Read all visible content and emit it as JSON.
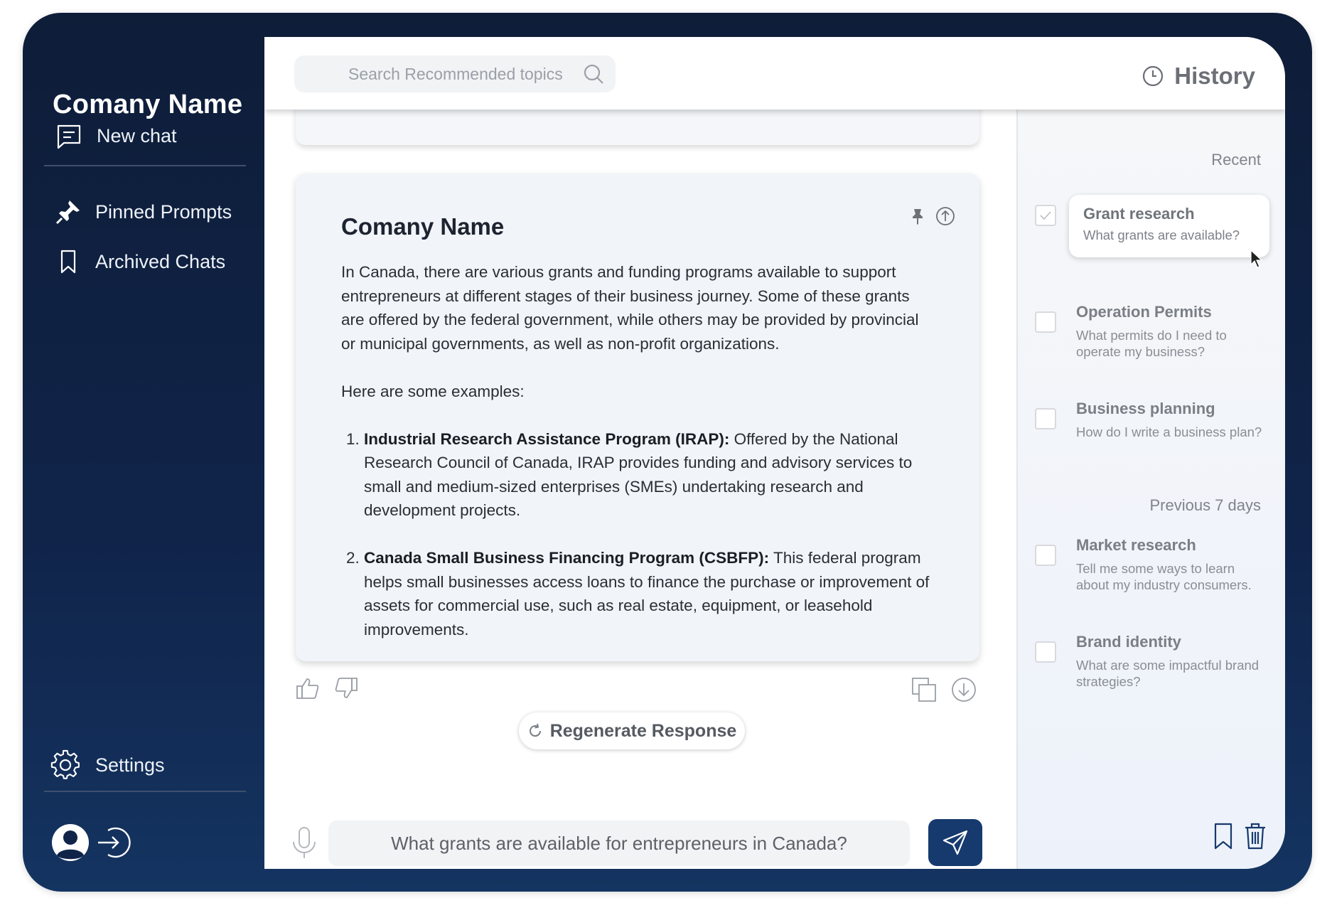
{
  "sidebar": {
    "brand": "Comany Name",
    "new_chat": "New chat",
    "pinned": "Pinned Prompts",
    "archived": "Archived Chats",
    "settings": "Settings"
  },
  "topbar": {
    "search_placeholder": "Search Recommended topics",
    "history_label": "History"
  },
  "message": {
    "title": "Comany Name",
    "intro": "In Canada, there are various grants and funding programs available to support entrepreneurs at different stages of their business journey. Some of these grants are offered by the federal government, while others may be provided by provincial or municipal governments, as well as non-profit organizations.",
    "examples_lead": "Here are some examples:",
    "items": [
      {
        "name": "Industrial Research Assistance Program (IRAP):",
        "desc": " Offered by the National Research Council of Canada, IRAP provides funding and advisory services to small and medium-sized enterprises (SMEs) undertaking research and development projects."
      },
      {
        "name": "Canada Small Business Financing Program (CSBFP):",
        "desc": " This federal program helps small businesses access loans to finance the purchase or improvement of assets for commercial use, such as real estate, equipment, or leasehold improvements."
      }
    ]
  },
  "regenerate_label": "Regenerate Response",
  "composer": {
    "value": "What grants are available for entrepreneurs in Canada?"
  },
  "history": {
    "recent_label": "Recent",
    "previous_label": "Previous 7 days",
    "recent": [
      {
        "title": "Grant research",
        "subtitle": "What grants are available?",
        "checked": true
      },
      {
        "title": "Operation Permits",
        "subtitle": "What permits do I need to operate my business?"
      },
      {
        "title": "Business planning",
        "subtitle": "How do I write a business plan?"
      }
    ],
    "previous": [
      {
        "title": "Market research",
        "subtitle": "Tell me some ways to learn about my industry consumers."
      },
      {
        "title": "Brand identity",
        "subtitle": "What are some impactful brand strategies?"
      }
    ]
  },
  "colors": {
    "sidebar_bg": "#10244a",
    "accent": "#163a6e"
  }
}
